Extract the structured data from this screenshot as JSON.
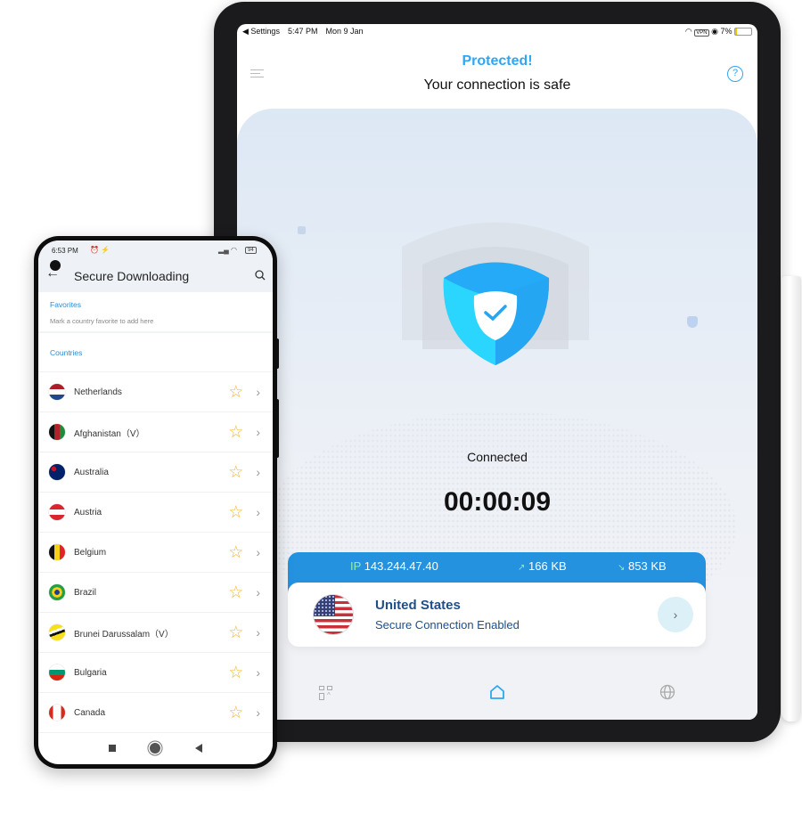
{
  "tablet": {
    "status": {
      "back": "◀ Settings",
      "time": "5:47 PM",
      "date": "Mon 9 Jan",
      "vpn": "VPN",
      "battery": "7%"
    },
    "header": {
      "title": "Protected!",
      "subtitle": "Your connection is safe",
      "menu_icon": "menu-icon",
      "help_icon": "help-icon"
    },
    "status_label": "Connected",
    "timer": "00:00:09",
    "info": {
      "ip_label": "IP",
      "ip": "143.244.47.40",
      "upload": "166 KB",
      "download": "853 KB"
    },
    "location": {
      "country": "United States",
      "status": "Secure Connection Enabled"
    },
    "nav": [
      "apps-icon",
      "home-icon",
      "globe-icon"
    ],
    "colors": {
      "accent": "#2ea6f2",
      "info_bar": "#2592e0",
      "location_text": "#1e4f8a"
    }
  },
  "phone": {
    "status": {
      "time": "6:53 PM",
      "battery": "94"
    },
    "header": {
      "title": "Secure Downloading"
    },
    "favorites": {
      "title": "Favorites",
      "hint": "Mark a country favorite to add here"
    },
    "countries_title": "Countries",
    "countries": [
      {
        "name": "Netherlands",
        "flag": "nl"
      },
      {
        "name": "Afghanistan（V）",
        "flag": "af"
      },
      {
        "name": "Australia",
        "flag": "au"
      },
      {
        "name": "Austria",
        "flag": "at"
      },
      {
        "name": "Belgium",
        "flag": "be"
      },
      {
        "name": "Brazil",
        "flag": "br"
      },
      {
        "name": "Brunei Darussalam（V）",
        "flag": "bn"
      },
      {
        "name": "Bulgaria",
        "flag": "bg"
      },
      {
        "name": "Canada",
        "flag": "ca"
      }
    ]
  }
}
